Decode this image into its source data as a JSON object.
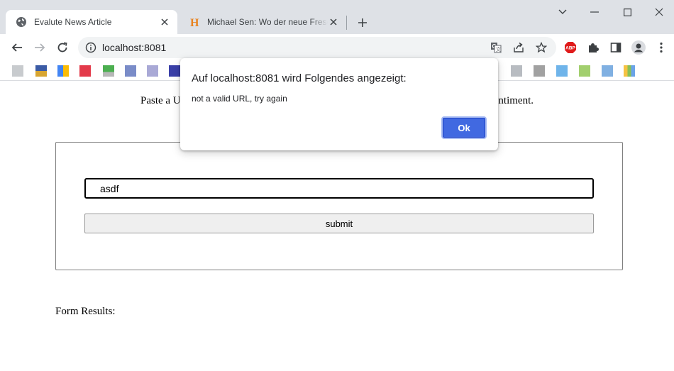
{
  "browser": {
    "tabs": [
      {
        "title": "Evalute News Article",
        "favicon": "globe-icon",
        "active": true
      },
      {
        "title": "Michael Sen: Wo der neue Fresenius",
        "favicon": "h-logo-icon",
        "active": false
      }
    ],
    "url": "localhost:8081",
    "extension_badge": "ABP"
  },
  "page": {
    "intro_text": "Paste a URL that l                                                                                          ity and sentiment.",
    "input_value": "asdf",
    "submit_label": "submit",
    "results_label": "Form Results:"
  },
  "dialog": {
    "title": "Auf localhost:8081 wird Folgendes angezeigt:",
    "message": "not a valid URL, try again",
    "ok_label": "Ok"
  },
  "colors": {
    "accent": "#4169e1",
    "abp_red": "#e01b1b",
    "tab_logo_orange": "#e8821e"
  }
}
